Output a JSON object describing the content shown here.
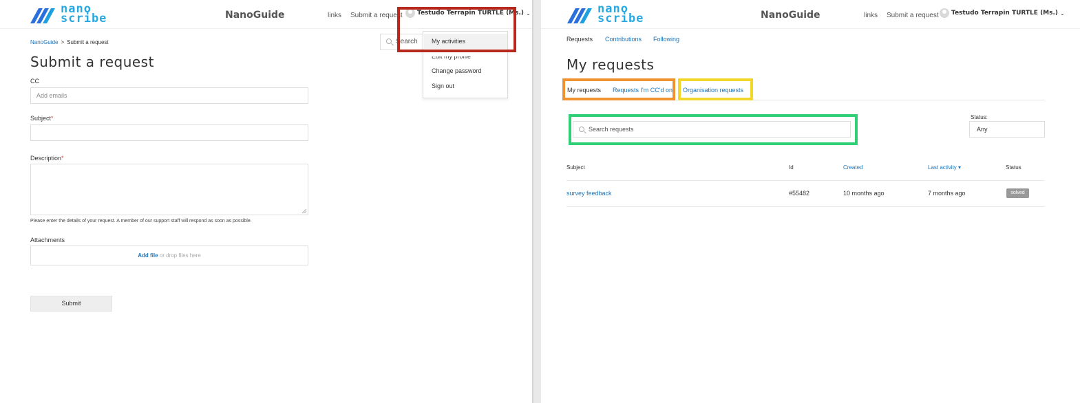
{
  "colors": {
    "accent": "#1f73b7",
    "logo": "#2aa8e0",
    "highlight_red": "#b7281d",
    "highlight_orange": "#f0922f",
    "highlight_yellow": "#f2d62a",
    "highlight_green": "#2fcf75",
    "badge": "#999999"
  },
  "header": {
    "logo_line1": "nano",
    "logo_line2": "scribe",
    "brand": "NanoGuide",
    "links_label": "links",
    "submit_request_label": "Submit a request",
    "user_name": "Testudo Terrapin TURTLE (Ms.)",
    "user_icon": "avatar-icon",
    "chevron_icon": "chevron-down-icon"
  },
  "left": {
    "breadcrumb": {
      "home": "NanoGuide",
      "separator": ">",
      "current": "Submit a request"
    },
    "title": "Submit a request",
    "cc_label": "CC",
    "cc_placeholder": "Add emails",
    "subject_label": "Subject",
    "description_label": "Description",
    "required_mark": "*",
    "hint": "Please enter the details of your request. A member of our support staff will respond as soon as possible.",
    "attachments_label": "Attachments",
    "add_file": "Add file",
    "drop_text": "or drop files here",
    "submit_label": "Submit",
    "search_label": "Search",
    "dropdown": {
      "items": [
        "My activities",
        "Edit my profile",
        "Change password",
        "Sign out"
      ]
    }
  },
  "right": {
    "top_tabs": [
      "Requests",
      "Contributions",
      "Following"
    ],
    "title": "My requests",
    "sub_tabs": [
      "My requests",
      "Requests I'm CC'd on",
      "Organisation requests"
    ],
    "search_placeholder": "Search requests",
    "status_label": "Status:",
    "status_value": "Any",
    "table": {
      "headers": [
        "Subject",
        "Id",
        "Created",
        "Last activity ▾",
        "Status"
      ],
      "rows": [
        {
          "subject": "survey feedback",
          "id": "#55482",
          "created": "10 months ago",
          "last_activity": "7 months ago",
          "status": "solved"
        }
      ]
    }
  }
}
